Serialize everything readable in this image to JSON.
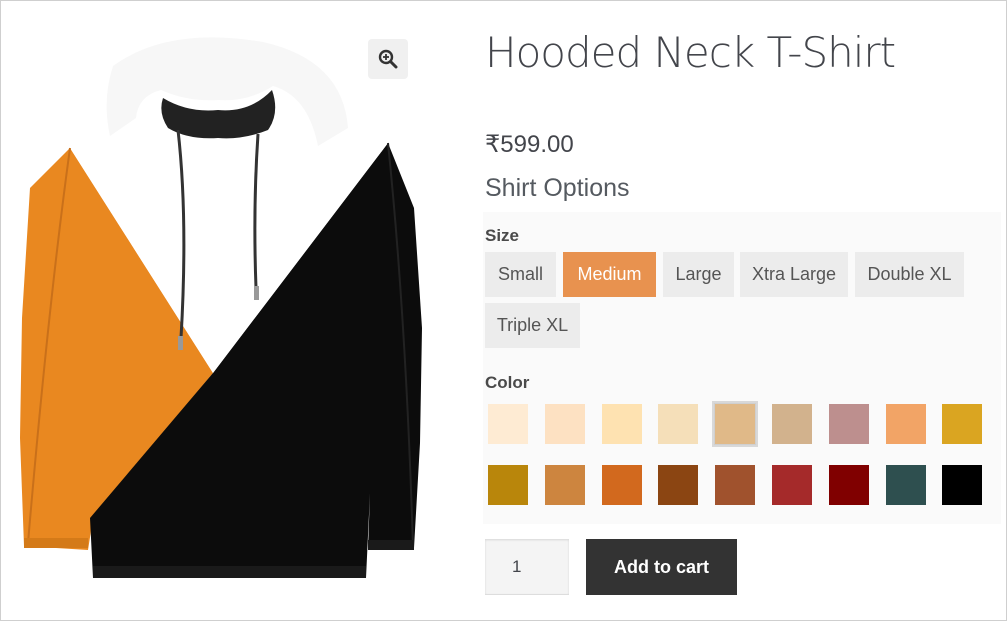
{
  "product": {
    "title": "Hooded Neck T-Shirt",
    "price": "₹599.00",
    "image_alt": "orange-white-black-hoodie",
    "zoom_icon": "magnifier-plus-icon"
  },
  "options": {
    "title": "Shirt Options",
    "size": {
      "label": "Size",
      "items": [
        "Small",
        "Medium",
        "Large",
        "Xtra Large",
        "Double XL",
        "Triple XL"
      ],
      "selected": "Medium"
    },
    "color": {
      "label": "Color",
      "swatches": [
        "#feebd3",
        "#fde1c2",
        "#fee2b1",
        "#f5dfb9",
        "#e0b988",
        "#d2b28d",
        "#bd8f8e",
        "#f2a466",
        "#daa521",
        "#b9860b",
        "#cd853f",
        "#d2691e",
        "#8b4512",
        "#a0522d",
        "#a52a2a",
        "#800000",
        "#2e4f4f",
        "#000000"
      ],
      "selected_index": 4
    }
  },
  "cart": {
    "quantity": "1",
    "add_label": "Add to cart"
  },
  "colors": {
    "accent": "#e8924f",
    "button_dark": "#333333"
  }
}
